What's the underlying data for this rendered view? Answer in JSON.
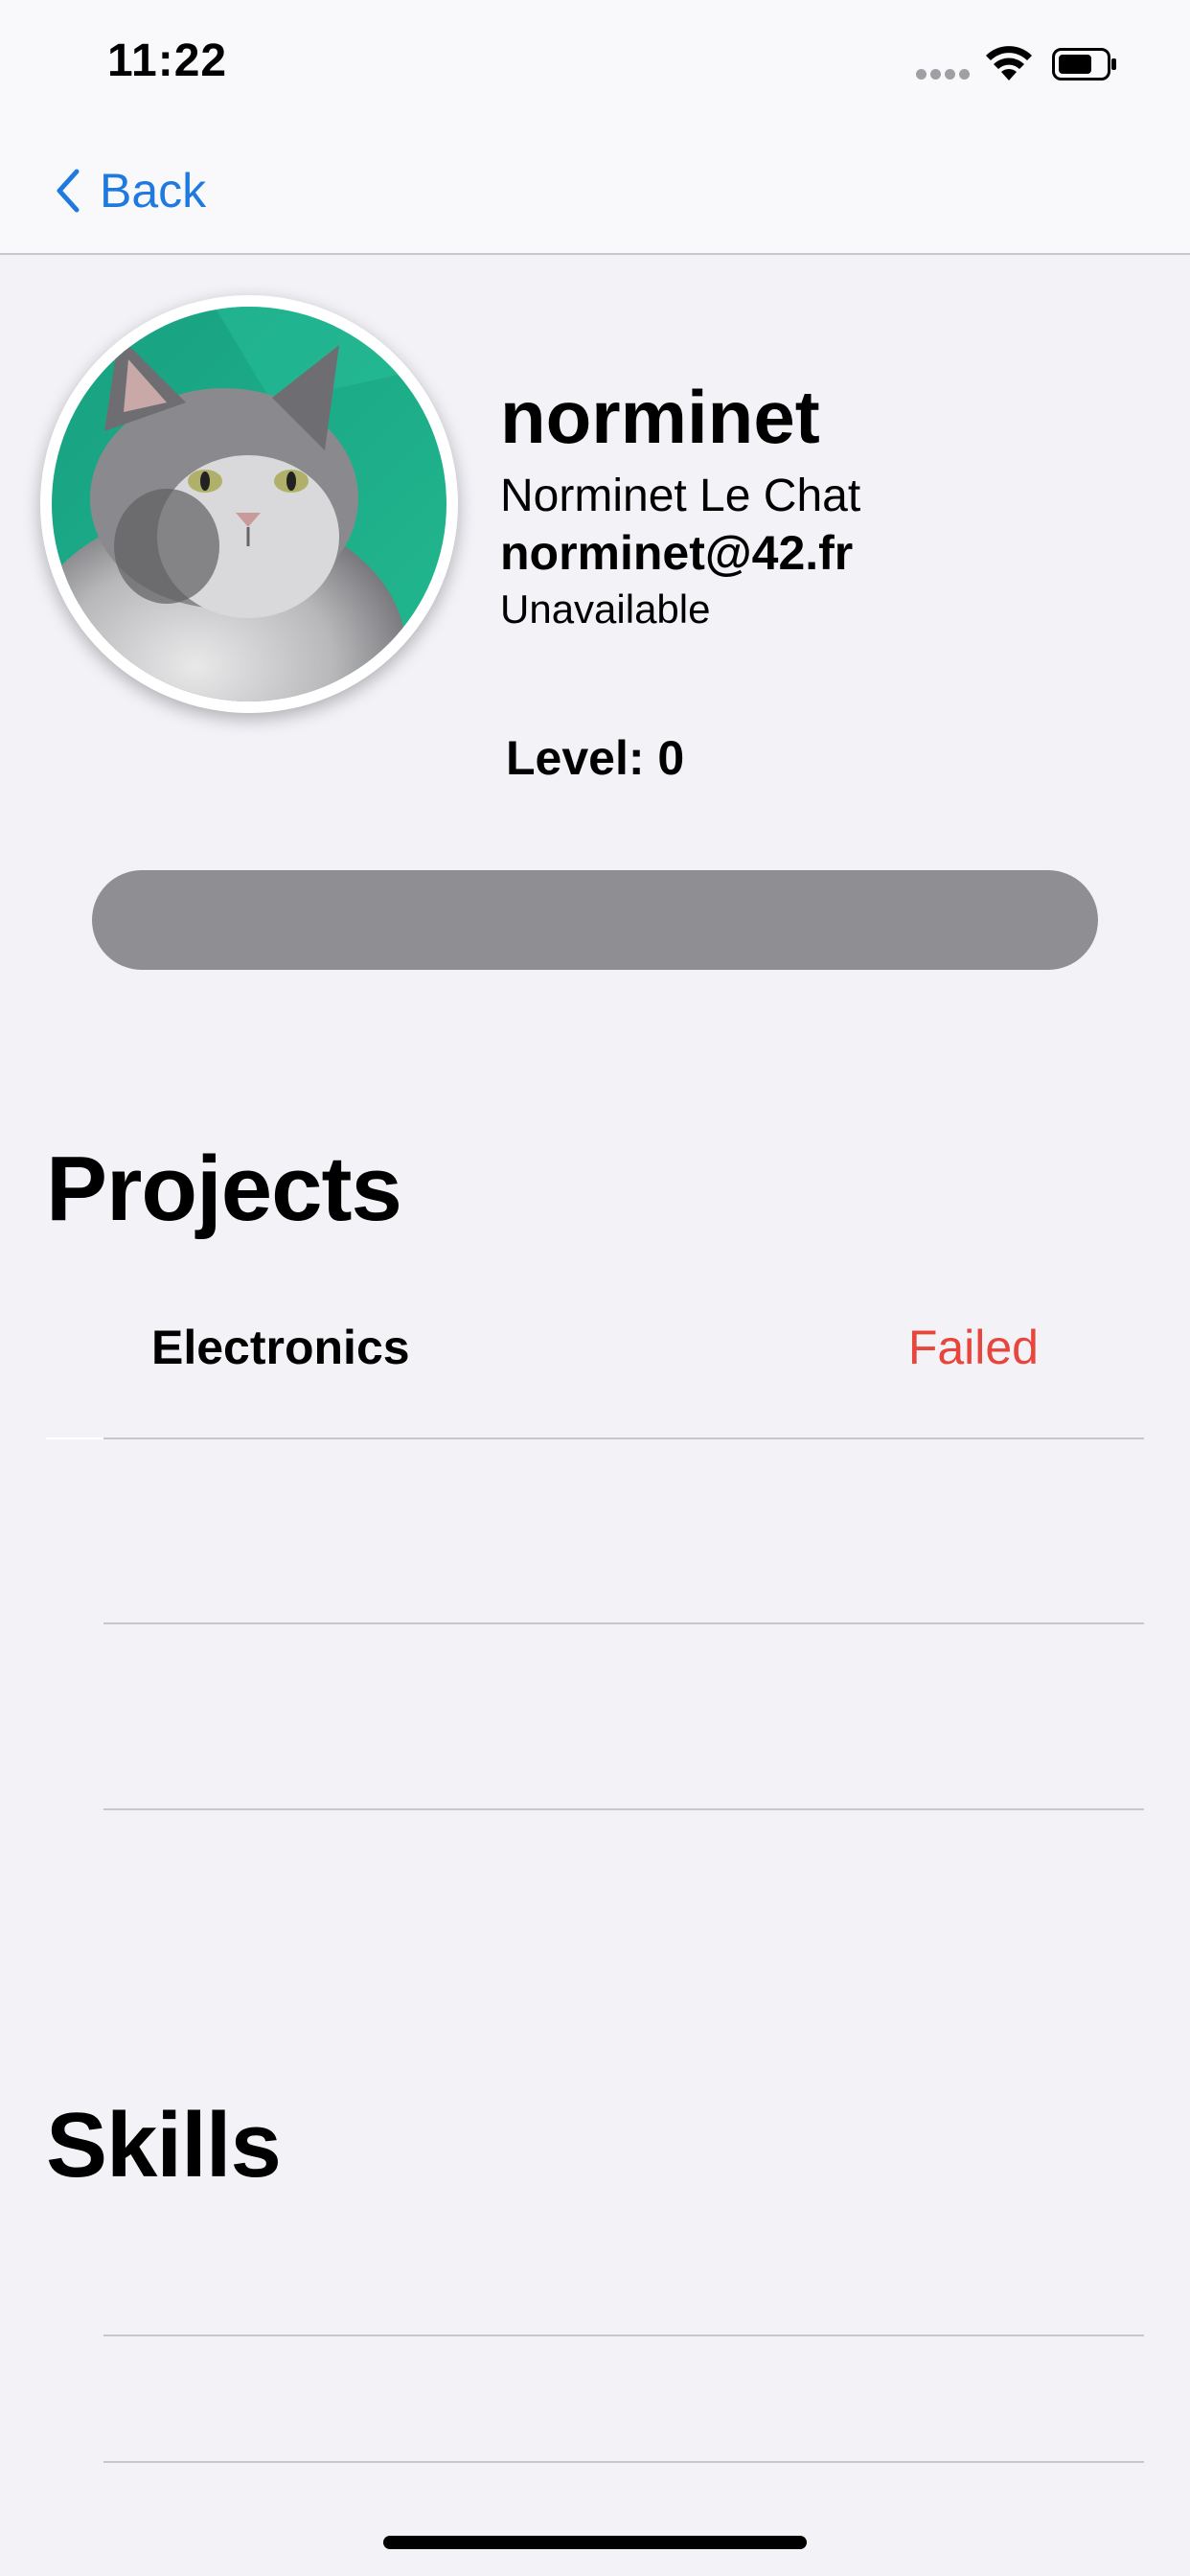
{
  "status_bar": {
    "time": "11:22"
  },
  "nav": {
    "back_label": "Back",
    "back_icon": "chevron-left-icon"
  },
  "profile": {
    "login": "norminet",
    "full_name": "Norminet Le Chat",
    "email": "norminet@42.fr",
    "availability": "Unavailable",
    "level_label": "Level: 0",
    "level_progress": 0,
    "avatar_description_icon": "cat-avatar"
  },
  "projects": {
    "title": "Projects",
    "items": [
      {
        "name": "Electronics",
        "status": "Failed",
        "status_color": "#e8453c"
      }
    ]
  },
  "skills": {
    "title": "Skills",
    "items": []
  },
  "colors": {
    "accent": "#1f7ae0",
    "failed": "#e8453c",
    "background": "#f2f2f7",
    "bar": "#8e8e93"
  }
}
